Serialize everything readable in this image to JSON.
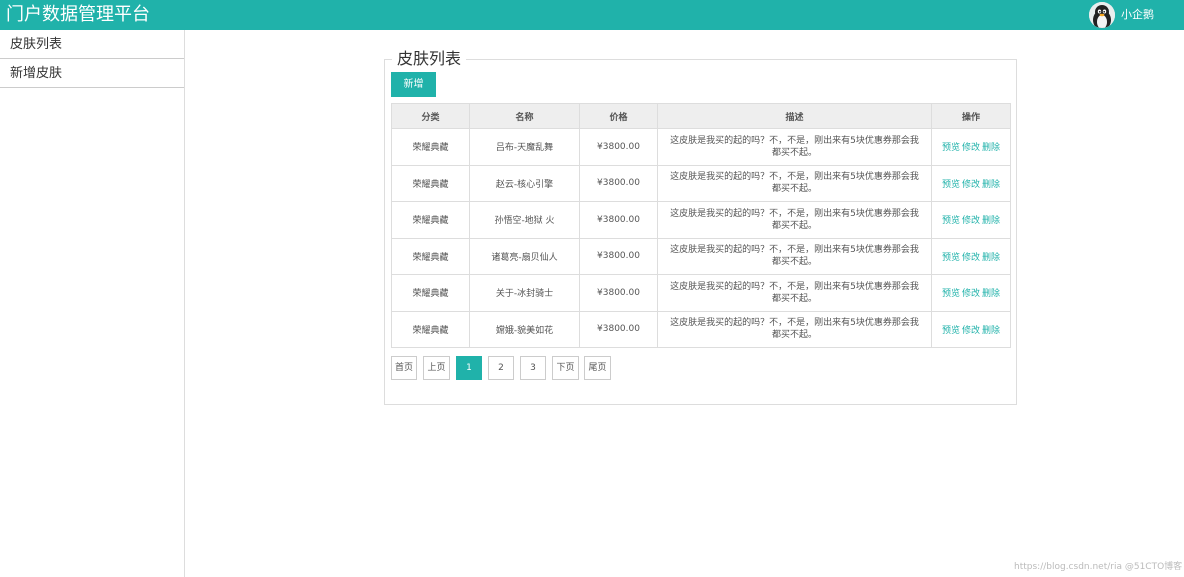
{
  "header": {
    "app_title": "门户数据管理平台",
    "username": "小企鹅"
  },
  "sidebar": {
    "items": [
      {
        "label": "皮肤列表"
      },
      {
        "label": "新增皮肤"
      }
    ]
  },
  "main": {
    "panel_title": "皮肤列表",
    "add_button": "新增",
    "columns": [
      "分类",
      "名称",
      "价格",
      "描述",
      "操作"
    ],
    "rows": [
      {
        "category": "荣耀典藏",
        "name": "吕布-天魔乱舞",
        "price": "¥3800.00",
        "desc": "这皮肤是我买的起的吗？不，不是，刚出来有5块优惠券那会我都买不起。"
      },
      {
        "category": "荣耀典藏",
        "name": "赵云-核心引擎",
        "price": "¥3800.00",
        "desc": "这皮肤是我买的起的吗？不，不是，刚出来有5块优惠券那会我都买不起。"
      },
      {
        "category": "荣耀典藏",
        "name": "孙悟空-地狱 火",
        "price": "¥3800.00",
        "desc": "这皮肤是我买的起的吗？不，不是，刚出来有5块优惠券那会我都买不起。"
      },
      {
        "category": "荣耀典藏",
        "name": "诸葛亮-扇贝仙人",
        "price": "¥3800.00",
        "desc": "这皮肤是我买的起的吗？不，不是，刚出来有5块优惠券那会我都买不起。"
      },
      {
        "category": "荣耀典藏",
        "name": "关于-冰封骑士",
        "price": "¥3800.00",
        "desc": "这皮肤是我买的起的吗？不，不是，刚出来有5块优惠券那会我都买不起。"
      },
      {
        "category": "荣耀典藏",
        "name": "嫦娥-貌美如花",
        "price": "¥3800.00",
        "desc": "这皮肤是我买的起的吗？不，不是，刚出来有5块优惠券那会我都买不起。"
      }
    ],
    "actions": {
      "preview": "预览",
      "edit": "修改",
      "delete": "删除"
    }
  },
  "pagination": {
    "first": "首页",
    "prev": "上页",
    "pages": [
      "1",
      "2",
      "3"
    ],
    "current_page": "1",
    "next": "下页",
    "last": "尾页"
  },
  "watermark": "https://blog.csdn.net/ria @51CTO博客",
  "colors": {
    "accent": "#20b2aa"
  }
}
